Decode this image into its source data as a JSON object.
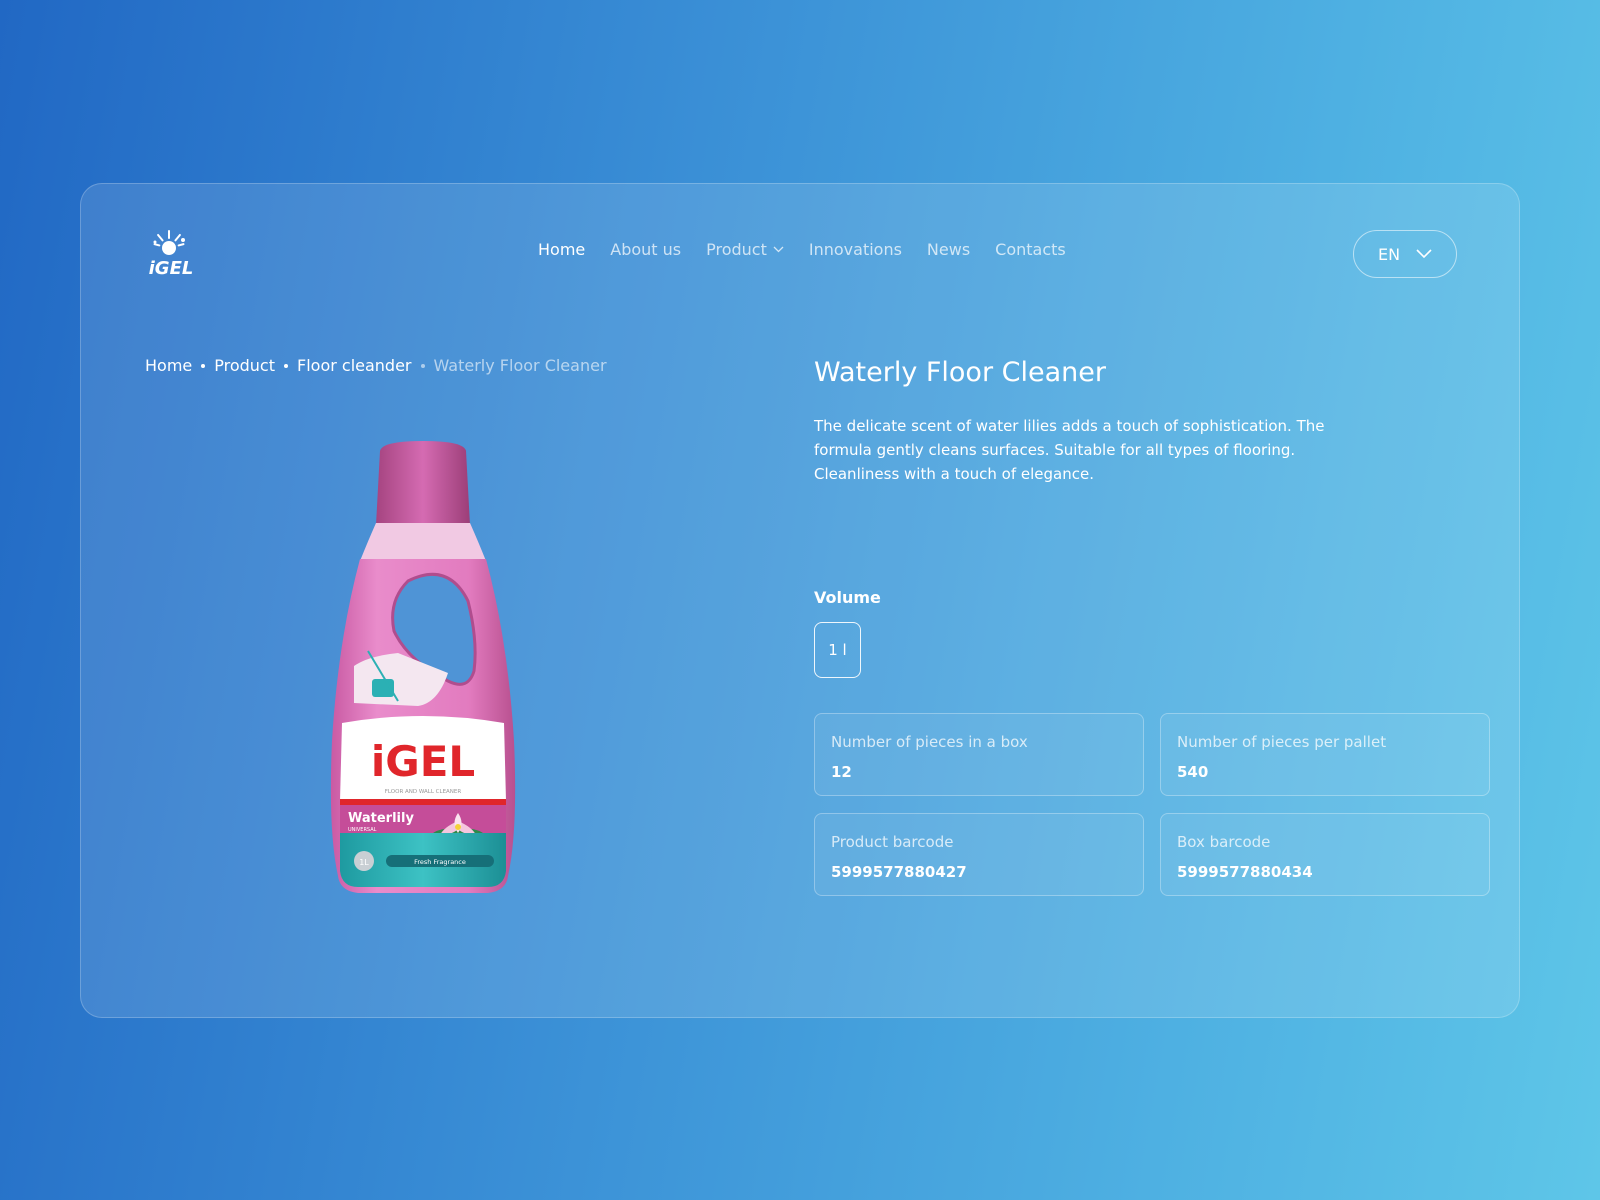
{
  "brand": {
    "logo_text": "iGEL"
  },
  "nav": {
    "items": [
      {
        "label": "Home",
        "active": true
      },
      {
        "label": "About us",
        "active": false
      },
      {
        "label": "Product",
        "active": false,
        "has_dropdown": true
      },
      {
        "label": "Innovations",
        "active": false
      },
      {
        "label": "News",
        "active": false
      },
      {
        "label": "Contacts",
        "active": false
      }
    ]
  },
  "language": {
    "selected": "EN"
  },
  "breadcrumb": [
    "Home",
    "Product",
    "Floor cleander",
    "Waterly Floor Cleaner"
  ],
  "product": {
    "title": "Waterly Floor Cleaner",
    "description": "The delicate scent of water lilies adds a touch of sophistication. The formula gently cleans surfaces. Suitable for all types of flooring. Cleanliness with a touch of elegance.",
    "volume_label": "Volume",
    "volume_options": [
      "1 l"
    ],
    "bottle_label": {
      "brand": "iGEL",
      "subtitle": "FLOOR AND WALL CLEANER",
      "variant": "Waterlily",
      "variant_sub": "UNIVERSAL",
      "size": "1L",
      "tagline": "Fresh Fragrance"
    },
    "specs": [
      {
        "label": "Number of pieces in a box",
        "value": "12"
      },
      {
        "label": "Number of pieces per pallet",
        "value": "540"
      },
      {
        "label": "Product barcode",
        "value": "5999577880427"
      },
      {
        "label": "Box barcode",
        "value": "5999577880434"
      }
    ]
  },
  "colors": {
    "bg_start": "#2168c4",
    "bg_end": "#5ec6e8",
    "bottle_pink": "#e27bbf",
    "brand_red": "#e0262b",
    "label_teal": "#2bb0b4"
  }
}
